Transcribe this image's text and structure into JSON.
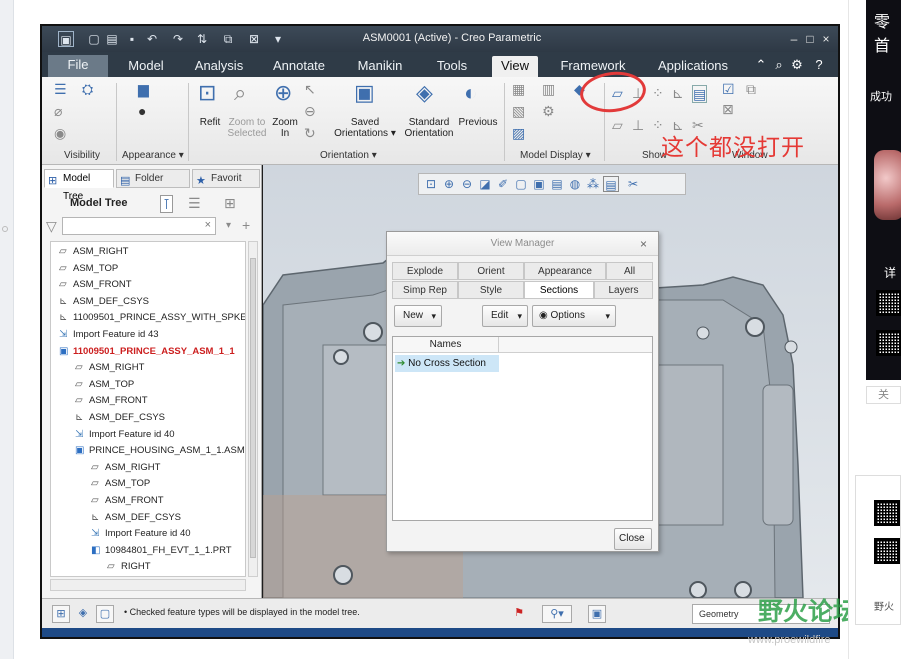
{
  "window": {
    "title": "ASM0001 (Active) - Creo Parametric",
    "min": "–",
    "max": "□",
    "close": "×"
  },
  "tabs": [
    {
      "label": "File"
    },
    {
      "label": "Model"
    },
    {
      "label": "Analysis"
    },
    {
      "label": "Annotate"
    },
    {
      "label": "Manikin"
    },
    {
      "label": "Tools"
    },
    {
      "label": "View"
    },
    {
      "label": "Framework"
    },
    {
      "label": "Applications"
    }
  ],
  "ribbon": {
    "refit": "Refit",
    "zoom_selected": "Zoom to\nSelected",
    "zoom_in": "Zoom\nIn",
    "saved_orientations": "Saved\nOrientations ▾",
    "standard_orientation": "Standard\nOrientation",
    "previous": "Previous",
    "groups": {
      "visibility": "Visibility",
      "appearance": "Appearance ▾",
      "orientation": "Orientation ▾",
      "model_display": "Model Display ▾",
      "show": "Show",
      "window": "Window"
    }
  },
  "panel": {
    "tabs": [
      "Model Tree",
      "Folder",
      "Favorit"
    ],
    "title": "Model Tree",
    "filter_clear": "×",
    "tree": [
      {
        "label": "ASM_RIGHT",
        "icon": "datum-plane-icon",
        "indent": 0
      },
      {
        "label": "ASM_TOP",
        "icon": "datum-plane-icon",
        "indent": 0
      },
      {
        "label": "ASM_FRONT",
        "icon": "datum-plane-icon",
        "indent": 0
      },
      {
        "label": "ASM_DEF_CSYS",
        "icon": "csys-icon",
        "indent": 0
      },
      {
        "label": "11009501_PRINCE_ASSY_WITH_SPKER",
        "icon": "csys-icon",
        "indent": 0
      },
      {
        "label": "Import Feature id 43",
        "icon": "import-icon",
        "indent": 0
      },
      {
        "label": "11009501_PRINCE_ASSY_ASM_1_1",
        "icon": "assembly-icon",
        "indent": 0,
        "active": true
      },
      {
        "label": "ASM_RIGHT",
        "icon": "datum-plane-icon",
        "indent": 1
      },
      {
        "label": "ASM_TOP",
        "icon": "datum-plane-icon",
        "indent": 1
      },
      {
        "label": "ASM_FRONT",
        "icon": "datum-plane-icon",
        "indent": 1
      },
      {
        "label": "ASM_DEF_CSYS",
        "icon": "csys-icon",
        "indent": 1
      },
      {
        "label": "Import Feature id 40",
        "icon": "import-icon",
        "indent": 1
      },
      {
        "label": "PRINCE_HOUSING_ASM_1_1.ASM",
        "icon": "assembly-icon",
        "indent": 1
      },
      {
        "label": "ASM_RIGHT",
        "icon": "datum-plane-icon",
        "indent": 2
      },
      {
        "label": "ASM_TOP",
        "icon": "datum-plane-icon",
        "indent": 2
      },
      {
        "label": "ASM_FRONT",
        "icon": "datum-plane-icon",
        "indent": 2
      },
      {
        "label": "ASM_DEF_CSYS",
        "icon": "csys-icon",
        "indent": 2
      },
      {
        "label": "Import Feature id 40",
        "icon": "import-icon",
        "indent": 2
      },
      {
        "label": "10984801_FH_EVT_1_1.PRT",
        "icon": "part-icon",
        "indent": 2
      },
      {
        "label": "RIGHT",
        "icon": "datum-plane-icon",
        "indent": 3
      }
    ]
  },
  "dialog": {
    "title": "View Manager",
    "close": "×",
    "tabs_row1": [
      "Explode",
      "Orient",
      "Appearance",
      "All"
    ],
    "tabs_row2": [
      "Simp Rep",
      "Style",
      "Sections",
      "Layers"
    ],
    "new_label": "New",
    "edit_label": "Edit",
    "options_label": "Options",
    "column_names": "Names",
    "rows": [
      "No Cross Section"
    ],
    "close_button": "Close"
  },
  "status": {
    "message": "• Checked feature types will be displayed in the model tree.",
    "filter": "Geometry"
  },
  "annotation": {
    "text": "这个都没打开",
    "color": "#e53935"
  },
  "watermark": {
    "brand": "野火论坛",
    "url": "www.proewildfire"
  },
  "ad": {
    "title": "零首",
    "success": "成功",
    "detail": "详",
    "close": "关",
    "bottom_text": "野火"
  },
  "colors": {
    "titlebar": "#2e3945",
    "active_node": "#cc1f1f",
    "selection": "#cde6f7",
    "model_gray": "#9aa4ad"
  }
}
